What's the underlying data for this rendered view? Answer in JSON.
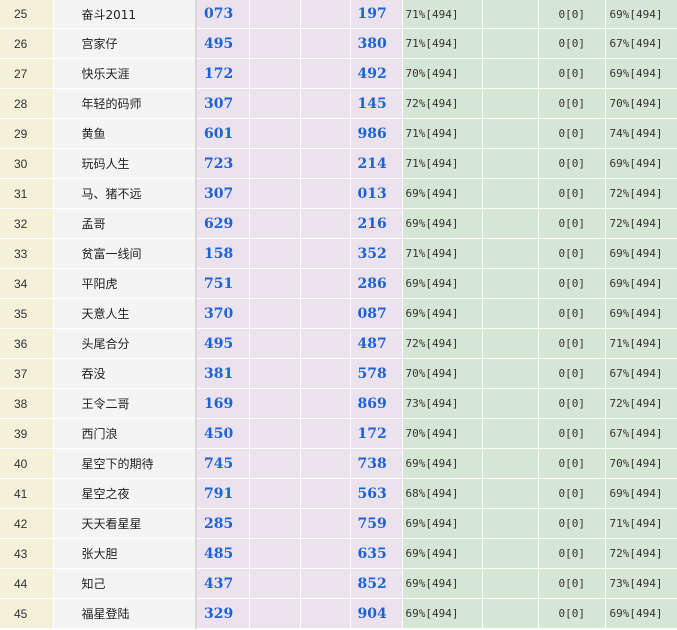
{
  "rows": [
    {
      "idx": "25",
      "name": "奋斗2011",
      "num_a": "073",
      "num_b": "197",
      "stat_1": "71%[494]",
      "stat_2": "0[0]",
      "stat_3": "0[0]",
      "stat_4": "69%[494]"
    },
    {
      "idx": "26",
      "name": "宫家仔",
      "num_a": "495",
      "num_b": "380",
      "stat_1": "71%[494]",
      "stat_2": "0[0]",
      "stat_3": "0[0]",
      "stat_4": "67%[494]"
    },
    {
      "idx": "27",
      "name": "快乐天涯",
      "num_a": "172",
      "num_b": "492",
      "stat_1": "70%[494]",
      "stat_2": "0[0]",
      "stat_3": "0[0]",
      "stat_4": "69%[494]"
    },
    {
      "idx": "28",
      "name": "年轻的码师",
      "num_a": "307",
      "num_b": "145",
      "stat_1": "72%[494]",
      "stat_2": "0[0]",
      "stat_3": "0[0]",
      "stat_4": "70%[494]"
    },
    {
      "idx": "29",
      "name": "黄鱼",
      "num_a": "601",
      "num_b": "986",
      "stat_1": "71%[494]",
      "stat_2": "0[0]",
      "stat_3": "0[0]",
      "stat_4": "74%[494]"
    },
    {
      "idx": "30",
      "name": "玩码人生",
      "num_a": "723",
      "num_b": "214",
      "stat_1": "71%[494]",
      "stat_2": "0[0]",
      "stat_3": "0[0]",
      "stat_4": "69%[494]"
    },
    {
      "idx": "31",
      "name": "马、猪不远",
      "num_a": "307",
      "num_b": "013",
      "stat_1": "69%[494]",
      "stat_2": "0[0]",
      "stat_3": "0[0]",
      "stat_4": "72%[494]"
    },
    {
      "idx": "32",
      "name": "孟哥",
      "num_a": "629",
      "num_b": "216",
      "stat_1": "69%[494]",
      "stat_2": "0[0]",
      "stat_3": "0[0]",
      "stat_4": "72%[494]"
    },
    {
      "idx": "33",
      "name": "贫富一线间",
      "num_a": "158",
      "num_b": "352",
      "stat_1": "71%[494]",
      "stat_2": "0[0]",
      "stat_3": "0[0]",
      "stat_4": "69%[494]"
    },
    {
      "idx": "34",
      "name": "平阳虎",
      "num_a": "751",
      "num_b": "286",
      "stat_1": "69%[494]",
      "stat_2": "0[0]",
      "stat_3": "0[0]",
      "stat_4": "69%[494]"
    },
    {
      "idx": "35",
      "name": "天意人生",
      "num_a": "370",
      "num_b": "087",
      "stat_1": "69%[494]",
      "stat_2": "0[0]",
      "stat_3": "0[0]",
      "stat_4": "69%[494]"
    },
    {
      "idx": "36",
      "name": "头尾合分",
      "num_a": "495",
      "num_b": "487",
      "stat_1": "72%[494]",
      "stat_2": "0[0]",
      "stat_3": "0[0]",
      "stat_4": "71%[494]"
    },
    {
      "idx": "37",
      "name": "吞没",
      "num_a": "381",
      "num_b": "578",
      "stat_1": "70%[494]",
      "stat_2": "0[0]",
      "stat_3": "0[0]",
      "stat_4": "67%[494]"
    },
    {
      "idx": "38",
      "name": "王令二哥",
      "num_a": "169",
      "num_b": "869",
      "stat_1": "73%[494]",
      "stat_2": "0[0]",
      "stat_3": "0[0]",
      "stat_4": "72%[494]"
    },
    {
      "idx": "39",
      "name": "西门浪",
      "num_a": "450",
      "num_b": "172",
      "stat_1": "70%[494]",
      "stat_2": "0[0]",
      "stat_3": "0[0]",
      "stat_4": "67%[494]"
    },
    {
      "idx": "40",
      "name": "星空下的期待",
      "num_a": "745",
      "num_b": "738",
      "stat_1": "69%[494]",
      "stat_2": "0[0]",
      "stat_3": "0[0]",
      "stat_4": "70%[494]"
    },
    {
      "idx": "41",
      "name": "星空之夜",
      "num_a": "791",
      "num_b": "563",
      "stat_1": "68%[494]",
      "stat_2": "0[0]",
      "stat_3": "0[0]",
      "stat_4": "69%[494]"
    },
    {
      "idx": "42",
      "name": "天天看星星",
      "num_a": "285",
      "num_b": "759",
      "stat_1": "69%[494]",
      "stat_2": "0[0]",
      "stat_3": "0[0]",
      "stat_4": "71%[494]"
    },
    {
      "idx": "43",
      "name": "张大胆",
      "num_a": "485",
      "num_b": "635",
      "stat_1": "69%[494]",
      "stat_2": "0[0]",
      "stat_3": "0[0]",
      "stat_4": "72%[494]"
    },
    {
      "idx": "44",
      "name": "知己",
      "num_a": "437",
      "num_b": "852",
      "stat_1": "69%[494]",
      "stat_2": "0[0]",
      "stat_3": "0[0]",
      "stat_4": "73%[494]"
    },
    {
      "idx": "45",
      "name": "福星登陆",
      "num_a": "329",
      "num_b": "904",
      "stat_1": "69%[494]",
      "stat_2": "0[0]",
      "stat_3": "0[0]",
      "stat_4": "69%[494]"
    }
  ]
}
